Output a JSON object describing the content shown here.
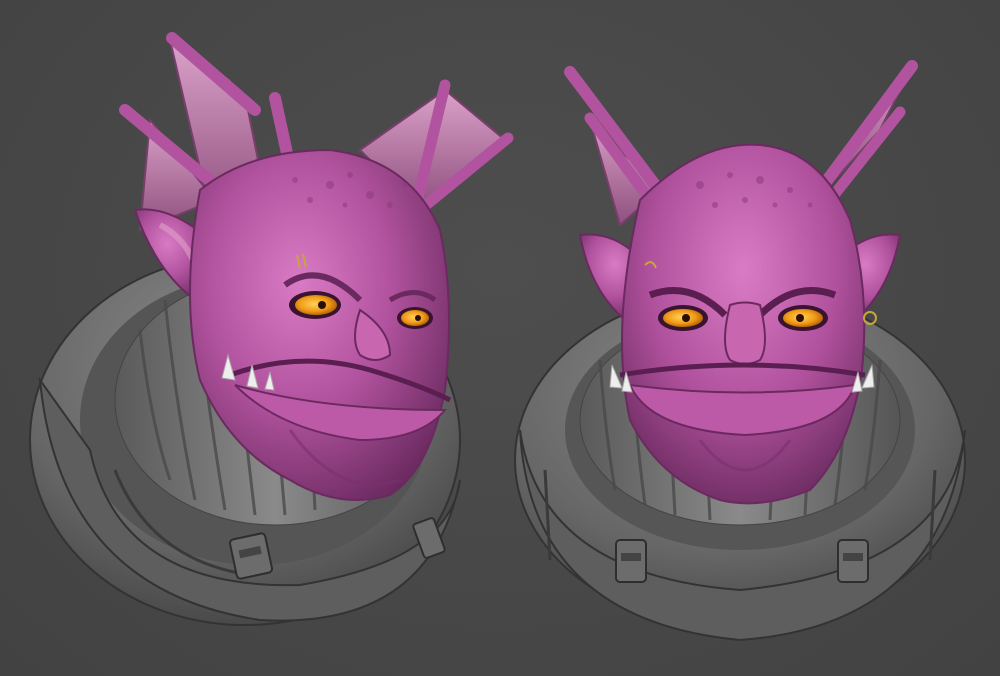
{
  "scene": {
    "background_color": "#4a4a4a",
    "skin_color": "#b2539f",
    "skin_highlight": "#d57ac2",
    "skin_shadow": "#6e2a62",
    "fin_color": "#c98ab8",
    "eye_color": "#f0a21c",
    "collar_color": "#6a6a6a",
    "views": [
      {
        "id": "three-quarter-view",
        "subject": "purple-alien-bust"
      },
      {
        "id": "front-view",
        "subject": "purple-alien-bust"
      }
    ]
  }
}
